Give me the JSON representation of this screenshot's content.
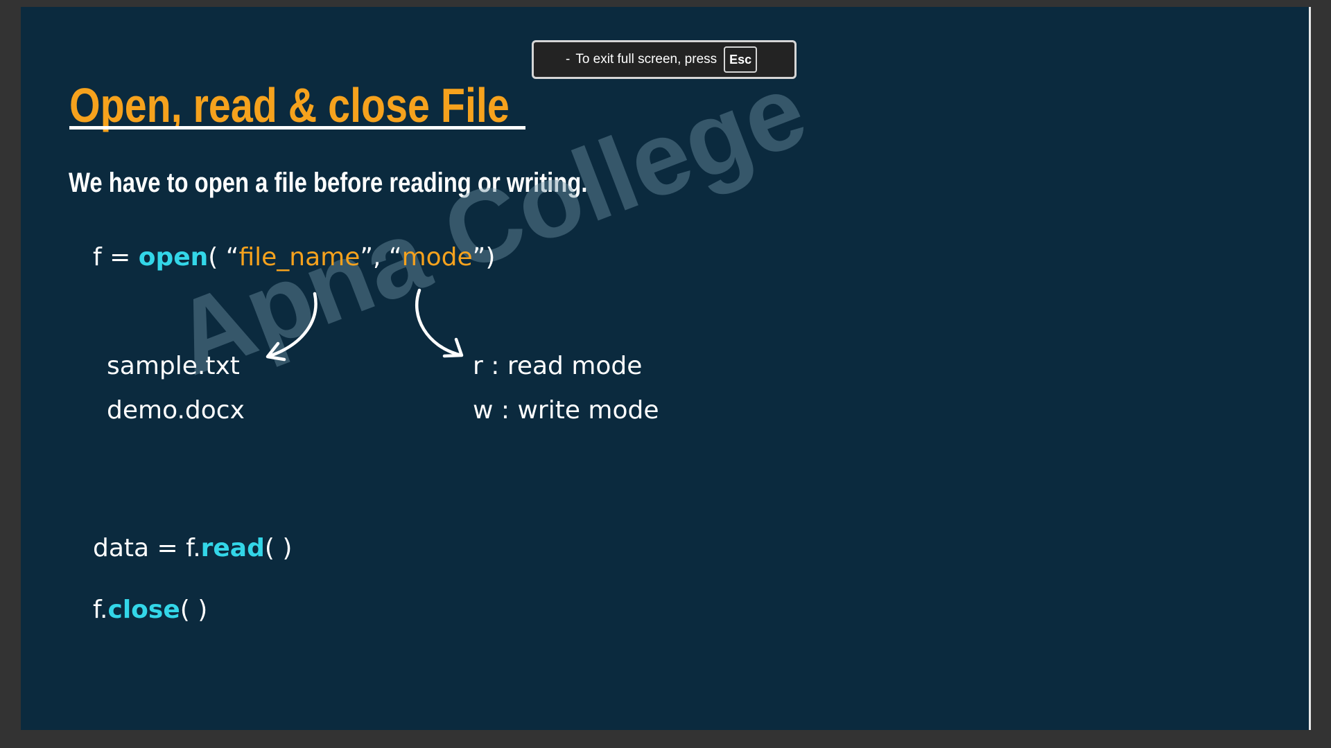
{
  "toast": {
    "dash": "-",
    "message": "To exit full screen, press",
    "key": "Esc"
  },
  "slide": {
    "title": "Open, read & close File",
    "subtitle": "We have to open a file before reading or writing.",
    "watermark": "Apna College",
    "open_line": {
      "lhs": "f = ",
      "func": "open",
      "paren_open": "( ",
      "q1_open": "“",
      "arg1": "file_name",
      "q1_close": "”",
      "sep": ", ",
      "q2_open": "“",
      "arg2": "mode",
      "q2_close": "”",
      "paren_close": ")"
    },
    "file_examples": [
      "sample.txt",
      "demo.docx"
    ],
    "modes": [
      "r : read mode",
      "w : write mode"
    ],
    "read_line": {
      "lhs": "data = f.",
      "func": "read",
      "parens": "( )"
    },
    "close_line": {
      "lhs": "f.",
      "func": "close",
      "parens": "( )"
    }
  },
  "colors": {
    "slide_bg": "#0b2a3e",
    "title": "#f6a21d",
    "keyword": "#33d6e8",
    "string": "#f6a21d",
    "text": "#ffffff"
  }
}
